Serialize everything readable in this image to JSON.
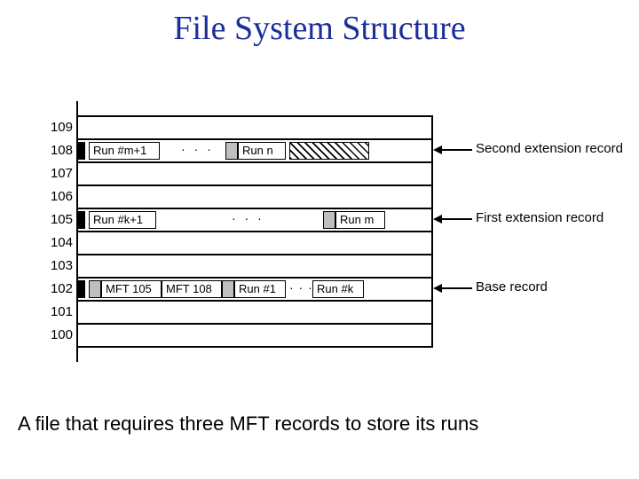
{
  "title": "File System Structure",
  "rows": {
    "n109": "109",
    "n108": "108",
    "n107": "107",
    "n106": "106",
    "n105": "105",
    "n104": "104",
    "n103": "103",
    "n102": "102",
    "n101": "101",
    "n100": "100"
  },
  "cells": {
    "run_m1": "Run #m+1",
    "run_n": "Run n",
    "run_k1": "Run #k+1",
    "run_m": "Run m",
    "mft105": "MFT 105",
    "mft108": "MFT 108",
    "run_1": "Run #1",
    "run_k": "Run #k",
    "dots": "· · ·"
  },
  "labels": {
    "second_ext": "Second extension record",
    "first_ext": "First extension record",
    "base": "Base record"
  },
  "caption": "A file that requires three MFT records to store its runs"
}
